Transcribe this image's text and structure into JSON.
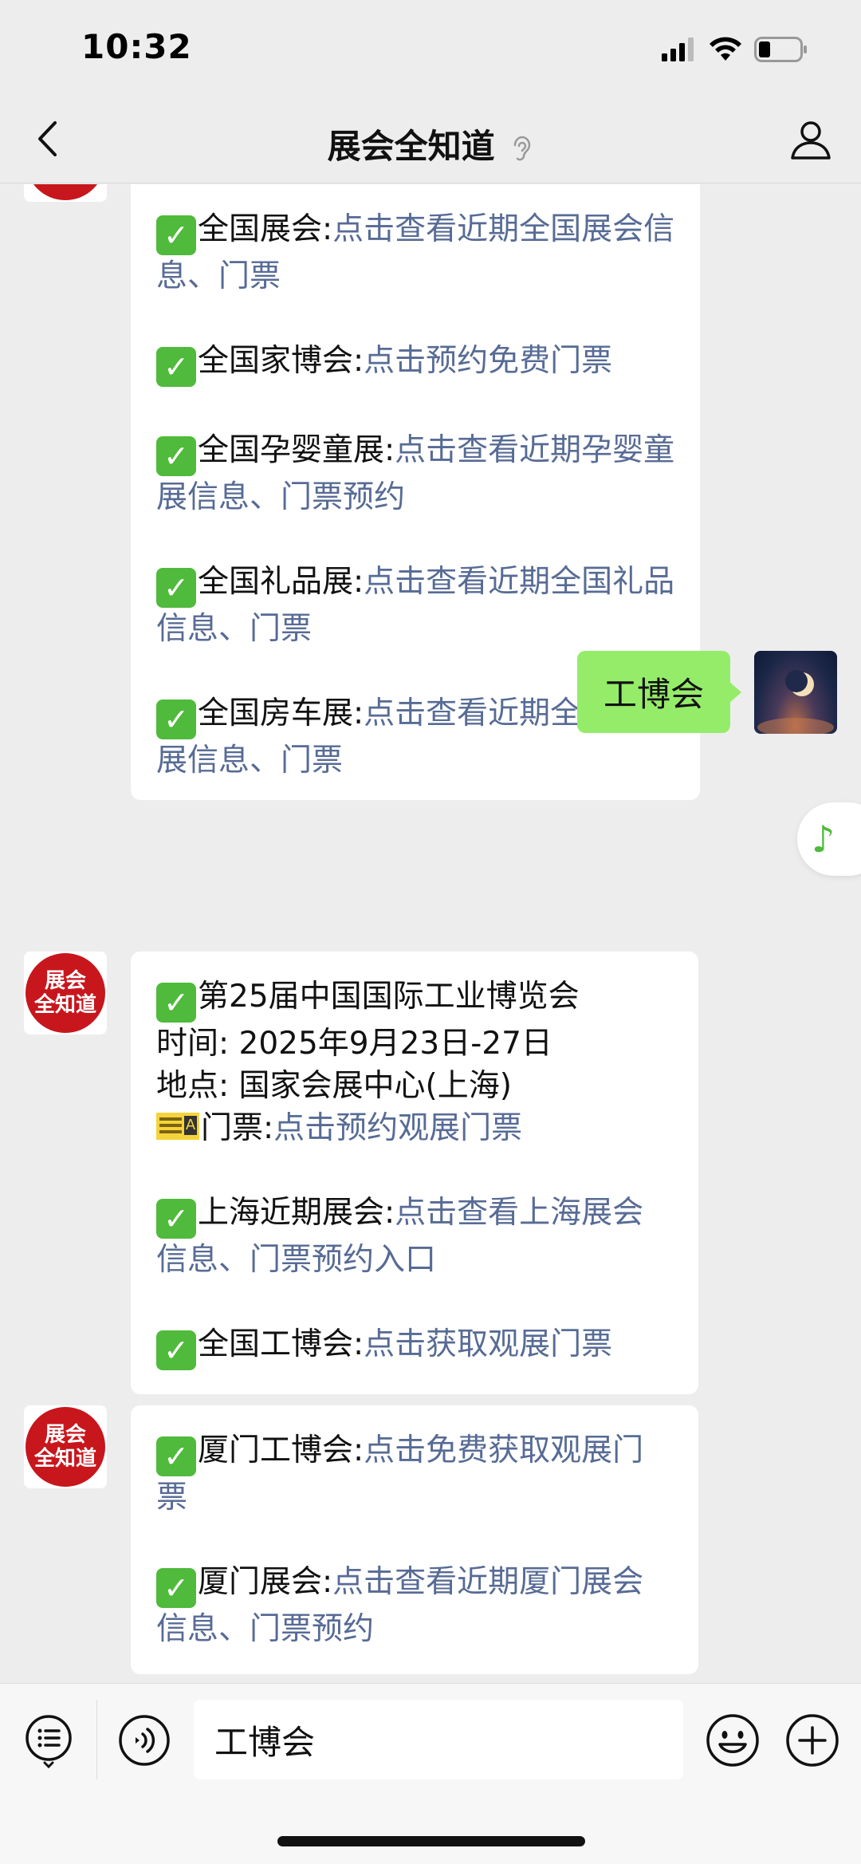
{
  "status_bar": {
    "time": "10:32"
  },
  "nav": {
    "title": "展会全知道",
    "back_icon": "chevron-left-icon",
    "ear_icon": "ear-icon",
    "profile_icon": "person-icon"
  },
  "avatar_logo": {
    "line1": "展会",
    "line2": "全知道",
    "color": "#c8161d"
  },
  "messages": {
    "m1": {
      "items": [
        {
          "label": "全国展会:",
          "link": "点击查看近期全国展会信息、门票"
        },
        {
          "label": "全国家博会:",
          "link": "点击预约免费门票"
        },
        {
          "label": "全国孕婴童展:",
          "link": "点击查看近期孕婴童展信息、门票预约"
        },
        {
          "label": "全国礼品展:",
          "link": "点击查看近期全国礼品信息、门票"
        },
        {
          "label": "全国房车展:",
          "link": "点击查看近期全国房车展信息、门票"
        }
      ]
    },
    "sent": {
      "text": "工博会"
    },
    "m2": {
      "title": "第25届中国国际工业博览会",
      "time_line": "时间: 2025年9月23日-27日",
      "place_line": "地点: 国家会展中心(上海)",
      "ticket_label": "门票:",
      "ticket_link": "点击预约观展门票",
      "items": [
        {
          "label": "上海近期展会:",
          "link": "点击查看上海展会信息、门票预约入口"
        },
        {
          "label": "全国工博会:",
          "link": "点击获取观展门票"
        }
      ]
    },
    "m3": {
      "items": [
        {
          "label": "厦门工博会:",
          "link": "点击免费获取观展门票"
        },
        {
          "label": "厦门展会:",
          "link": "点击查看近期厦门展会信息、门票预约"
        }
      ]
    }
  },
  "check_icon": "✓",
  "music_icon": "♪",
  "input_bar": {
    "value": "工博会",
    "menu_icon": "menu-list-icon",
    "voice_icon": "voice-icon",
    "emoji_icon": "emoji-icon",
    "plus_icon": "plus-icon"
  },
  "colors": {
    "link": "#576b95",
    "sent_bubble": "#95ec69",
    "check": "#4fba3b"
  }
}
